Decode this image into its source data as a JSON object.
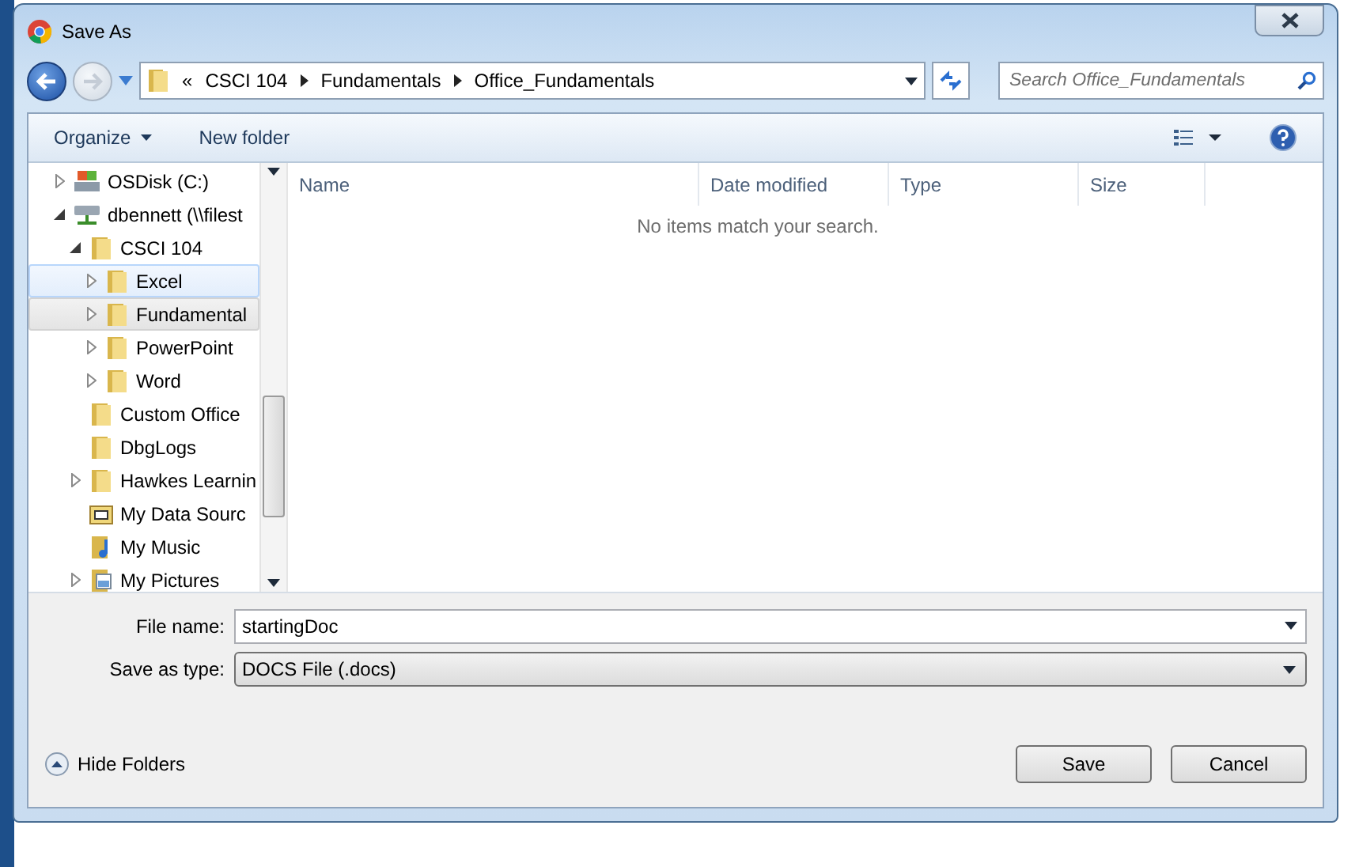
{
  "window": {
    "title": "Save As"
  },
  "breadcrumb": {
    "overflow": "«",
    "parts": [
      "CSCI 104",
      "Fundamentals",
      "Office_Fundamentals"
    ]
  },
  "search": {
    "placeholder": "Search Office_Fundamentals"
  },
  "toolbar": {
    "organize": "Organize",
    "new_folder": "New folder"
  },
  "tree": [
    {
      "label": "OSDisk (C:)",
      "kind": "drive",
      "expanded": false,
      "selected": false,
      "hovered": false
    },
    {
      "label": "dbennett (\\\\filest",
      "kind": "network",
      "expanded": true,
      "selected": false,
      "hovered": false,
      "children": [
        {
          "label": "CSCI 104",
          "kind": "folder",
          "expanded": true,
          "selected": false,
          "hovered": false,
          "children": [
            {
              "label": "Excel",
              "kind": "folder",
              "expanded": false,
              "selected": false,
              "hovered": true
            },
            {
              "label": "Fundamental",
              "kind": "folder",
              "expanded": false,
              "selected": true,
              "hovered": false
            },
            {
              "label": "PowerPoint",
              "kind": "folder",
              "expanded": false,
              "selected": false,
              "hovered": false
            },
            {
              "label": "Word",
              "kind": "folder",
              "expanded": false,
              "selected": false,
              "hovered": false
            }
          ]
        },
        {
          "label": "Custom Office",
          "kind": "folder",
          "selected": false,
          "hovered": false
        },
        {
          "label": "DbgLogs",
          "kind": "folder",
          "selected": false,
          "hovered": false
        },
        {
          "label": "Hawkes Learnin",
          "kind": "folder",
          "expanded": false,
          "selected": false,
          "hovered": false
        },
        {
          "label": "My Data Sourc",
          "kind": "datasource",
          "selected": false,
          "hovered": false
        },
        {
          "label": "My Music",
          "kind": "music",
          "selected": false,
          "hovered": false
        },
        {
          "label": "My Pictures",
          "kind": "pictures",
          "expanded": false,
          "selected": false,
          "hovered": false
        }
      ]
    }
  ],
  "table": {
    "columns": [
      "Name",
      "Date modified",
      "Type",
      "Size"
    ],
    "empty_message": "No items match your search."
  },
  "file_name": {
    "label": "File name:",
    "value": "startingDoc"
  },
  "save_type": {
    "label": "Save as type:",
    "value": "DOCS File (.docs)"
  },
  "hide_folders": "Hide Folders",
  "buttons": [
    "Save",
    "Cancel"
  ]
}
